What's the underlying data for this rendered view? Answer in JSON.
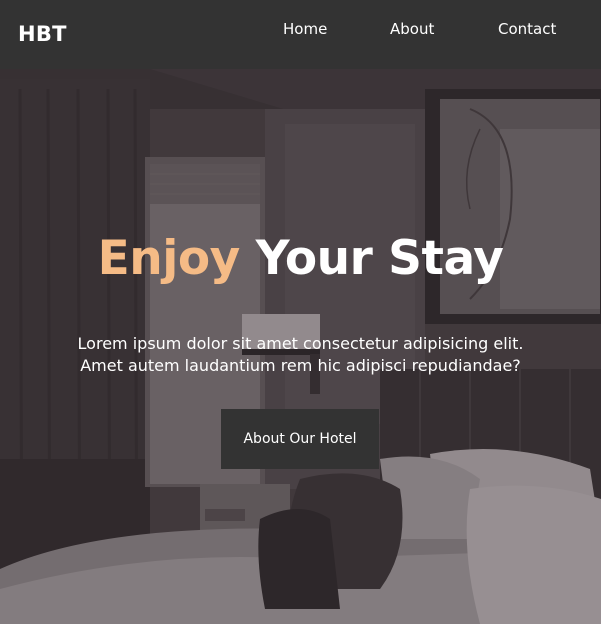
{
  "navbar": {
    "brand": "HBT",
    "links": [
      {
        "label": "Home"
      },
      {
        "label": "About"
      },
      {
        "label": "Contact"
      }
    ]
  },
  "hero": {
    "title_accent": "Enjoy",
    "title_rest": " Your Stay",
    "text_line1": "Lorem ipsum dolor sit amet consectetur adipisicing elit.",
    "text_line2": "Amet autem laudantium rem hic adipisci repudiandae?",
    "button_label": "About Our Hotel",
    "background_image": "hotel-room-photo"
  },
  "colors": {
    "navbar": "#333333",
    "accent": "#f5bb86",
    "text": "#ffffff",
    "button": "#333333"
  }
}
